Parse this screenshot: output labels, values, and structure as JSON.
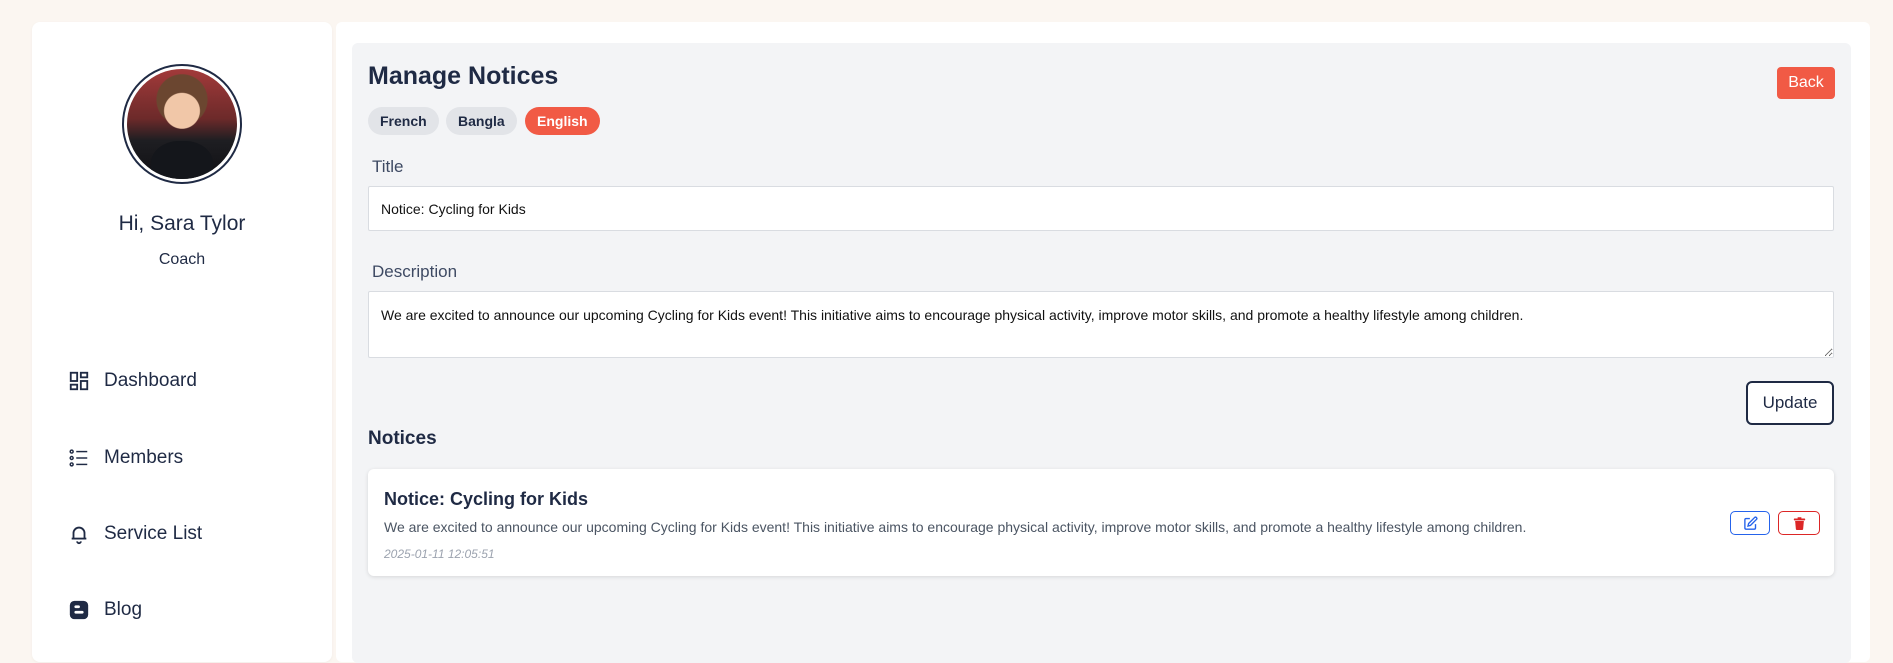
{
  "sidebar": {
    "greeting": "Hi, Sara Tylor",
    "role": "Coach",
    "items": [
      {
        "label": "Dashboard",
        "icon": "dashboard-icon"
      },
      {
        "label": "Members",
        "icon": "list-icon"
      },
      {
        "label": "Service List",
        "icon": "bell-icon"
      },
      {
        "label": "Blog",
        "icon": "blogger-icon"
      }
    ]
  },
  "header": {
    "title": "Manage Notices",
    "back_label": "Back"
  },
  "languages": [
    {
      "label": "French",
      "active": false
    },
    {
      "label": "Bangla",
      "active": false
    },
    {
      "label": "English",
      "active": true
    }
  ],
  "form": {
    "title_label": "Title",
    "title_value": "Notice: Cycling for Kids",
    "description_label": "Description",
    "description_value": "We are excited to announce our upcoming Cycling for Kids event! This initiative aims to encourage physical activity, improve motor skills, and promote a healthy lifestyle among children.",
    "update_label": "Update"
  },
  "notices": {
    "section_title": "Notices",
    "items": [
      {
        "title": "Notice: Cycling for Kids",
        "description": "We are excited to announce our upcoming Cycling for Kids event! This initiative aims to encourage physical activity, improve motor skills, and promote a healthy lifestyle among children.",
        "date": "2025-01-11 12:05:51"
      }
    ]
  },
  "colors": {
    "accent": "#f15a45",
    "primary_text": "#1f2a44",
    "edit": "#2563eb",
    "delete": "#dc2626"
  }
}
